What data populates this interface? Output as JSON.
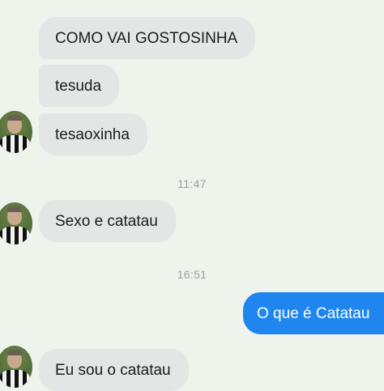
{
  "thread": {
    "messages": [
      {
        "text": "COMO VAI GOSTOSINHA"
      },
      {
        "text": "tesuda"
      },
      {
        "text": "tesaoxinha"
      },
      {
        "text": "Sexo e catatau"
      },
      {
        "text": "O que é Catatau"
      },
      {
        "text": "Eu sou o catatau"
      }
    ],
    "timestamps": [
      "11:47",
      "16:51"
    ]
  },
  "colors": {
    "background": "#eef3ec",
    "incoming_bubble": "#e3e6e4",
    "outgoing_bubble": "#1f86f0",
    "timestamp_text": "#9aa0a3"
  },
  "icons": [
    "contact-avatar"
  ]
}
